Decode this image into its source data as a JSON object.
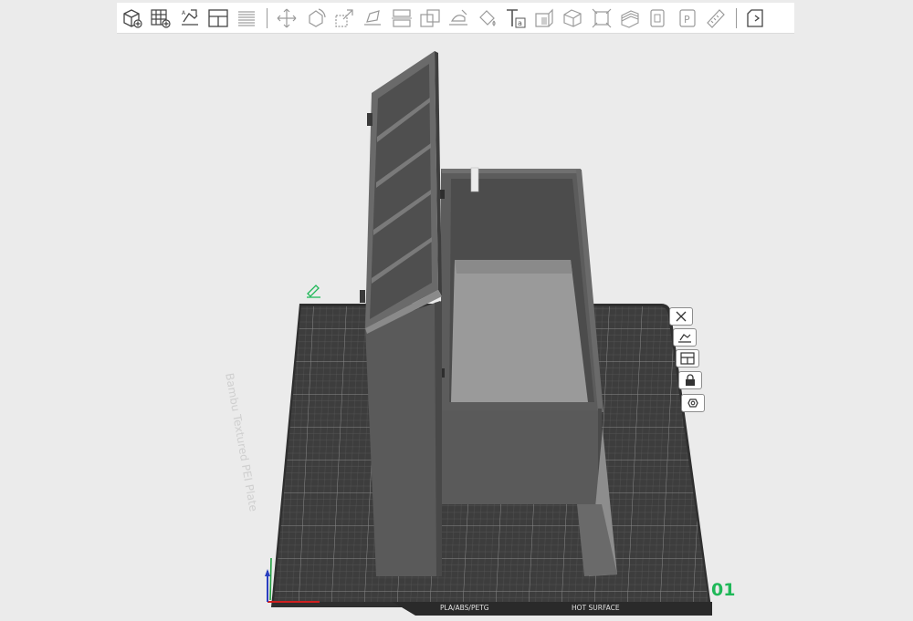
{
  "toolbar": {
    "groups": [
      [
        {
          "icon": "add-object-icon"
        },
        {
          "icon": "add-plate-icon"
        },
        {
          "icon": "auto-orient-icon"
        },
        {
          "icon": "arrange-icon"
        },
        {
          "icon": "split-icon"
        }
      ],
      [
        {
          "icon": "move-icon"
        },
        {
          "icon": "rotate-icon"
        },
        {
          "icon": "scale-icon"
        },
        {
          "icon": "lay-on-face-icon"
        },
        {
          "icon": "cut-icon"
        },
        {
          "icon": "boolean-icon"
        },
        {
          "icon": "support-paint-icon"
        },
        {
          "icon": "color-paint-icon"
        },
        {
          "icon": "text-icon"
        },
        {
          "icon": "seam-paint-icon"
        },
        {
          "icon": "measure-icon"
        },
        {
          "icon": "fuzzy-skin-icon"
        },
        {
          "icon": "variable-layer-icon"
        },
        {
          "icon": "assembly-icon"
        },
        {
          "icon": "part-icon"
        },
        {
          "icon": "ruler-icon"
        }
      ],
      [
        {
          "icon": "view-toggle-icon"
        }
      ]
    ]
  },
  "plate_buttons": [
    {
      "icon": "close-plate-icon"
    },
    {
      "icon": "orient-plate-icon"
    },
    {
      "icon": "arrange-plate-icon"
    },
    {
      "icon": "lock-plate-icon"
    },
    {
      "icon": "plate-settings-icon"
    }
  ],
  "plate": {
    "label": "Bambu Textured PEI Plate",
    "number": "01",
    "bed_tags": [
      "PLA/ABS/PETG",
      "HOT SURFACE"
    ]
  },
  "colors": {
    "background": "#ebebeb",
    "plate": "#3c3c3c",
    "grid": "#6a6a6a",
    "model": "#555555",
    "accent_green": "#1fb858"
  }
}
